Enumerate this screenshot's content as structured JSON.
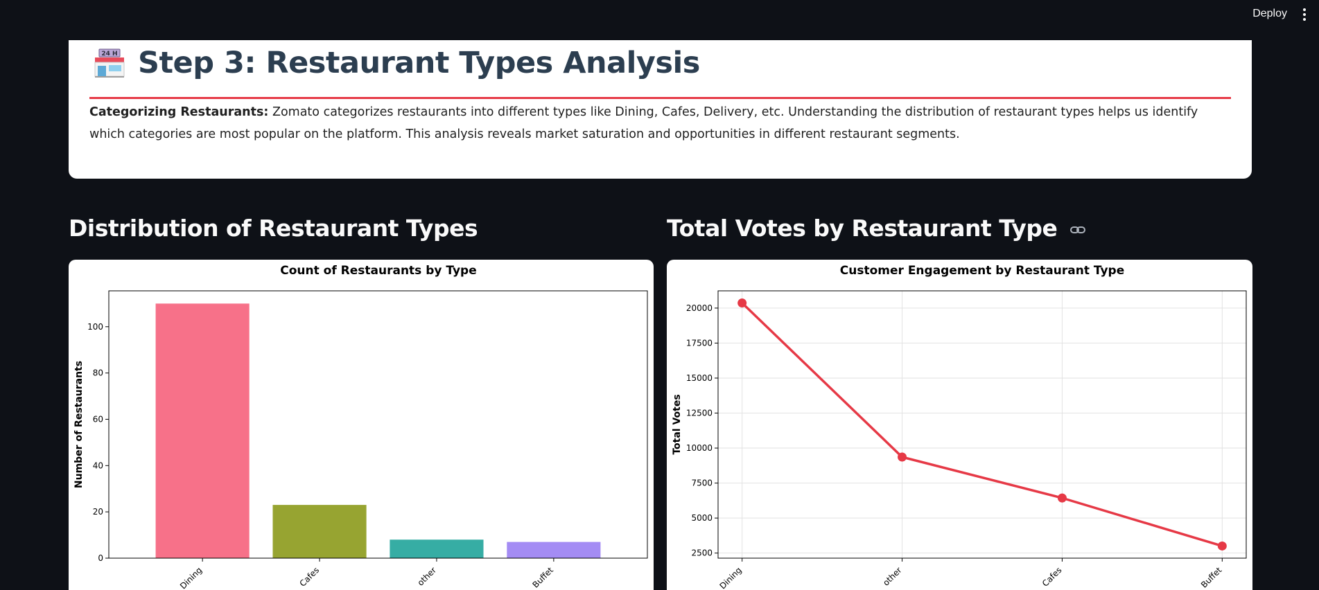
{
  "header": {
    "deploy_label": "Deploy",
    "menu_icon": "vertical-dots-icon"
  },
  "hero": {
    "icon": "convenience-store-icon",
    "icon_text": "24 H",
    "title": "Step 3: Restaurant Types Analysis",
    "lead": "Categorizing Restaurants:",
    "body": " Zomato categorizes restaurants into different types like Dining, Cafes, Delivery, etc. Understanding the distribution of restaurant types helps us identify which categories are most popular on the platform. This analysis reveals market saturation and opportunities in different restaurant segments.",
    "accent": "#e63946"
  },
  "sections": {
    "left_title": "Distribution of Restaurant Types",
    "right_title": "Total Votes by Restaurant Type"
  },
  "chart_data": [
    {
      "type": "bar",
      "title": "Count of Restaurants by Type",
      "xlabel": "",
      "ylabel": "Number of Restaurants",
      "categories": [
        "Dining",
        "Cafes",
        "other",
        "Buffet"
      ],
      "values": [
        110,
        23,
        8,
        7
      ],
      "colors": [
        "#f77189",
        "#97a431",
        "#36ada4",
        "#a48cf4"
      ],
      "ylim": [
        0,
        115.5
      ],
      "yticks": [
        0,
        20,
        40,
        60,
        80,
        100
      ],
      "grid": false
    },
    {
      "type": "line",
      "title": "Customer Engagement by Restaurant Type",
      "xlabel": "",
      "ylabel": "Total Votes",
      "categories": [
        "Dining",
        "other",
        "Cafes",
        "Buffet"
      ],
      "values": [
        20363,
        9359,
        6434,
        3005
      ],
      "color": "#e63946",
      "ylim": [
        2137,
        21231
      ],
      "yticks": [
        2500,
        5000,
        7500,
        10000,
        12500,
        15000,
        17500,
        20000
      ],
      "grid": true
    }
  ]
}
